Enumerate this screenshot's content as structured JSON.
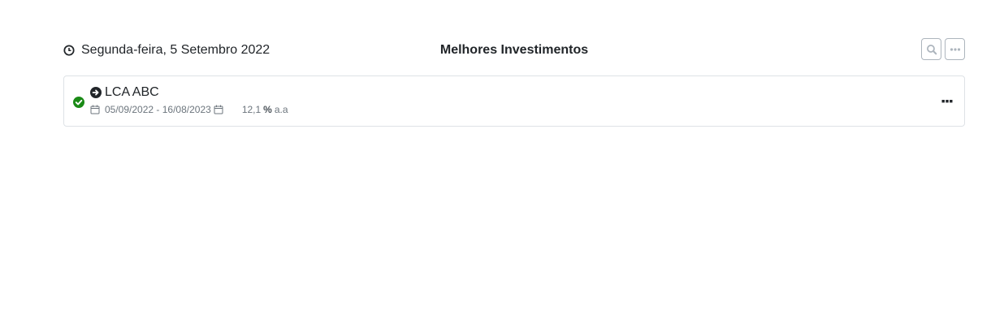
{
  "header": {
    "date": "Segunda-feira, 5 Setembro 2022",
    "title": "Melhores Investimentos",
    "search_icon": "search-icon",
    "more_icon": "ellipsis-icon"
  },
  "items": [
    {
      "name": "LCA ABC",
      "status_icon": "check-circle-icon",
      "status_color": "#1a8a16",
      "start_date": "05/09/2022",
      "date_separator": "-",
      "end_date": "16/08/2023",
      "rate": "12,1",
      "rate_symbol": "%",
      "rate_unit": "a.a"
    }
  ]
}
